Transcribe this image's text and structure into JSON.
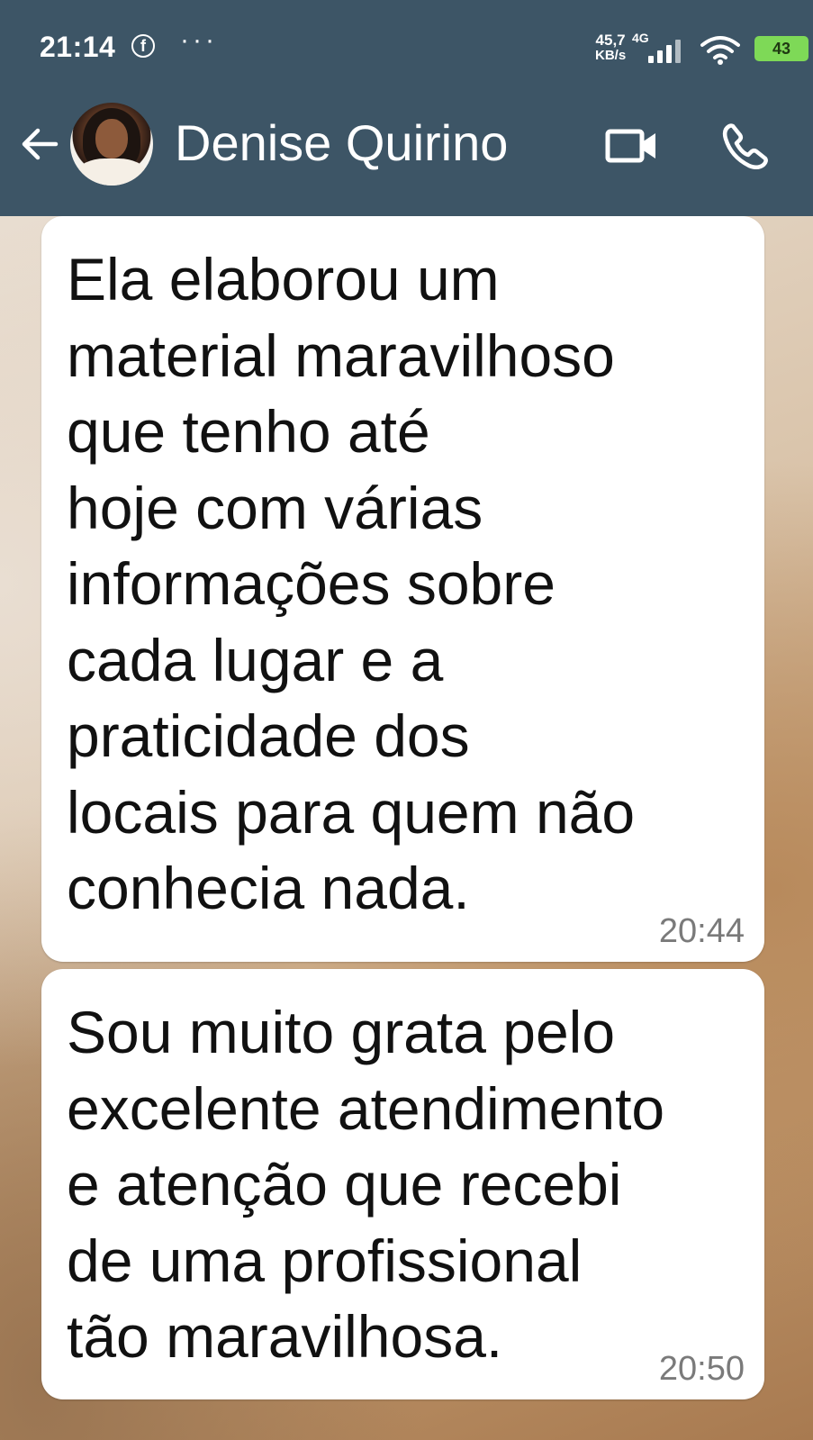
{
  "status_bar": {
    "time": "21:14",
    "net_speed": "45,7",
    "net_speed_unit": "KB/s",
    "network_type": "4G",
    "battery": "43"
  },
  "header": {
    "contact_name": "Denise Quirino"
  },
  "messages": [
    {
      "text": "Ela elaborou um\nmaterial maravilhoso\nque tenho até\nhoje com várias\ninformações sobre\ncada lugar e a\npraticidade dos\nlocais para quem não\nconhecia nada.",
      "time": "20:44"
    },
    {
      "text": "Sou muito grata pelo\nexcelente atendimento\ne atenção que recebi\nde uma profissional\ntão maravilhosa.",
      "time": "20:50"
    }
  ],
  "colors": {
    "header_bg": "#3d5566",
    "bubble_bg": "#ffffff",
    "battery": "#7ed957"
  }
}
